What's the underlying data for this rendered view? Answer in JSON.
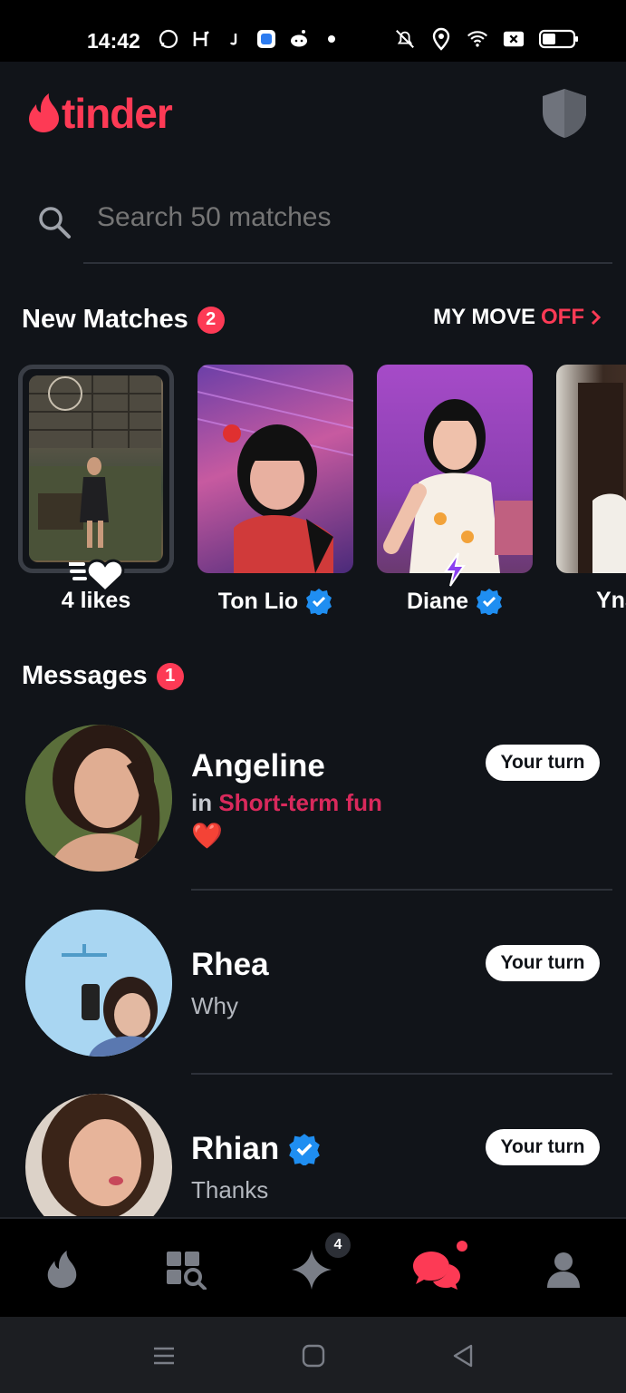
{
  "status_bar": {
    "time": "14:42",
    "left_icons": [
      "whatsapp-icon",
      "h-app-icon",
      "j-app-icon",
      "app-square-icon",
      "reddit-icon",
      "dot-icon"
    ],
    "right_icons": [
      "mute-icon",
      "location-icon",
      "wifi-icon",
      "sim-x-icon",
      "battery-icon"
    ]
  },
  "header": {
    "logo_text": "tinder",
    "brand_color": "#fd3a55"
  },
  "search": {
    "placeholder": "Search 50 matches"
  },
  "new_matches": {
    "title": "New Matches",
    "count": "2",
    "my_move_label": "MY MOVE",
    "my_move_state": "OFF",
    "items": [
      {
        "name": "4 likes",
        "verified": false
      },
      {
        "name": "Ton Lio",
        "verified": true
      },
      {
        "name": "Diane",
        "verified": true
      },
      {
        "name": "Yna",
        "verified": false
      }
    ]
  },
  "messages": {
    "title": "Messages",
    "count": "1",
    "items": [
      {
        "name": "Angeline",
        "context_prefix": "in",
        "context": "Short-term fun",
        "preview": "❤️",
        "action": "Your turn",
        "verified": false
      },
      {
        "name": "Rhea",
        "preview": "Why",
        "action": "Your turn",
        "verified": false
      },
      {
        "name": "Rhian",
        "preview": "Thanks",
        "action": "Your turn",
        "verified": true
      }
    ]
  },
  "tabbar": {
    "tabs": [
      "flame-tab",
      "explore-tab",
      "gold-tab",
      "chat-tab",
      "profile-tab"
    ],
    "gold_badge": "4",
    "active": "chat-tab",
    "active_color": "#fd3a55"
  }
}
